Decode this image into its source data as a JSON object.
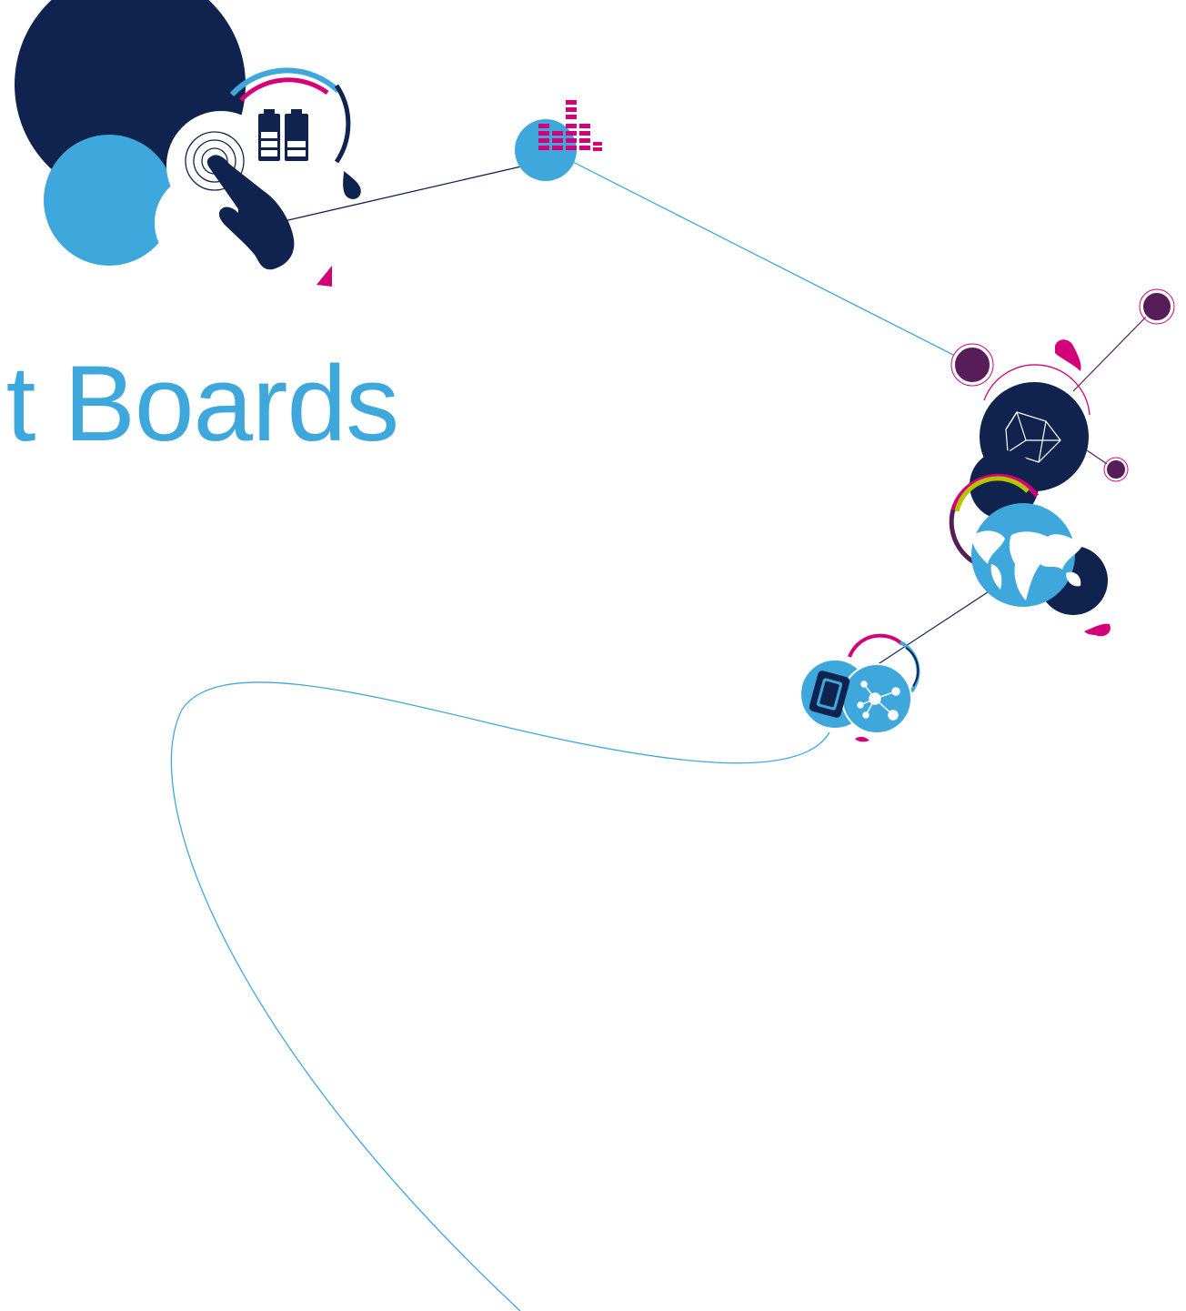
{
  "slide": {
    "title": "nt Boards"
  },
  "colors": {
    "navy": "#10224e",
    "light_blue": "#3ea8dc",
    "magenta": "#d4007a",
    "purple": "#561d59",
    "lime": "#b6c400",
    "white": "#ffffff"
  },
  "icons": [
    "touch-hand-icon",
    "battery-icon",
    "equalizer-icon",
    "cube-icon",
    "globe-icon",
    "chip-icon",
    "network-nodes-icon"
  ]
}
